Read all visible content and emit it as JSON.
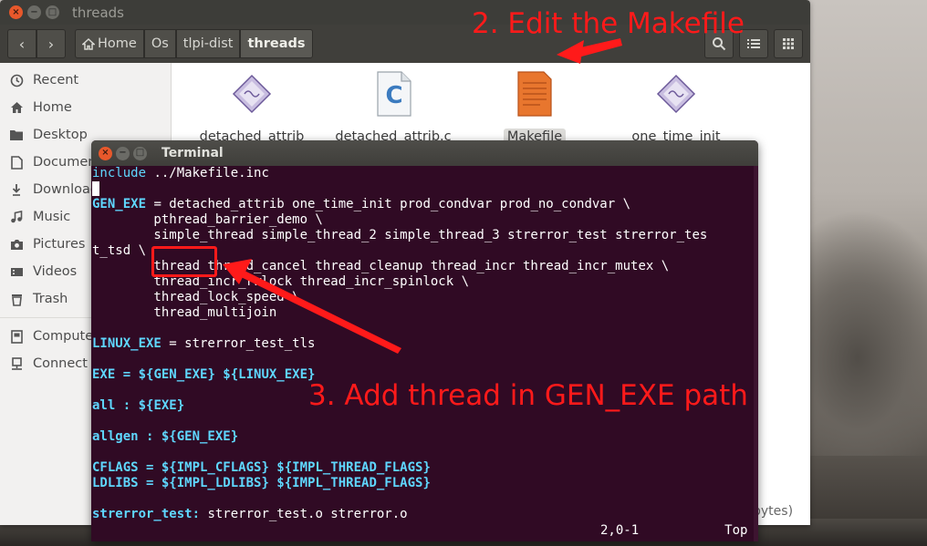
{
  "file_manager": {
    "title": "threads",
    "nav": {
      "back": "‹",
      "forward": "›"
    },
    "breadcrumbs": [
      "Home",
      "Os",
      "tlpi-dist",
      "threads"
    ],
    "sidebar": [
      {
        "label": "Recent",
        "icon": "clock-icon"
      },
      {
        "label": "Home",
        "icon": "home-icon"
      },
      {
        "label": "Desktop",
        "icon": "folder-icon"
      },
      {
        "label": "Documents",
        "icon": "document-icon"
      },
      {
        "label": "Downloads",
        "icon": "download-icon"
      },
      {
        "label": "Music",
        "icon": "music-icon"
      },
      {
        "label": "Pictures",
        "icon": "camera-icon"
      },
      {
        "label": "Videos",
        "icon": "video-icon"
      },
      {
        "label": "Trash",
        "icon": "trash-icon"
      },
      {
        "label": "Computer",
        "icon": "computer-icon"
      },
      {
        "label": "Connect to Server",
        "icon": "server-icon"
      }
    ],
    "files": [
      {
        "name": "detached_attrib",
        "type": "executable"
      },
      {
        "name": "detached_attrib.c",
        "type": "c-source"
      },
      {
        "name": "Makefile",
        "type": "makefile",
        "selected": true
      },
      {
        "name": "one_time_init",
        "type": "executable"
      }
    ],
    "status_fragment": "bytes)"
  },
  "terminal": {
    "title": "Terminal",
    "lines": [
      {
        "k": "include",
        "r": " ../Makefile.inc"
      },
      {
        "cursor": true
      },
      {
        "k": "GEN_EXE",
        "r": " = detached_attrib one_time_init prod_condvar prod_no_condvar \\"
      },
      {
        "r": "        pthread_barrier_demo \\"
      },
      {
        "r": "        simple_thread simple_thread_2 simple_thread_3 strerror_test strerror_tes"
      },
      {
        "r": "t_tsd \\"
      },
      {
        "r": "        thread thread_cancel thread_cleanup thread_incr thread_incr_mutex \\"
      },
      {
        "r": "        thread_incr_rwlock thread_incr_spinlock \\"
      },
      {
        "r": "        thread_lock_speed \\"
      },
      {
        "r": "        thread_multijoin"
      },
      {
        "r": ""
      },
      {
        "k": "LINUX_EXE",
        "r": " = strerror_test_tls"
      },
      {
        "r": ""
      },
      {
        "k": "EXE",
        "r": " = ${GEN_EXE} ${LINUX_EXE}",
        "bold": true
      },
      {
        "r": ""
      },
      {
        "k": "all",
        "r": " : ${EXE}",
        "bold": true
      },
      {
        "r": ""
      },
      {
        "k": "allgen",
        "r": " : ${GEN_EXE}",
        "bold": true
      },
      {
        "r": ""
      },
      {
        "k": "CFLAGS",
        "r": " = ${IMPL_CFLAGS} ${IMPL_THREAD_FLAGS}",
        "bold": true
      },
      {
        "k": "LDLIBS",
        "r": " = ${IMPL_LDLIBS} ${IMPL_THREAD_FLAGS}",
        "bold": true
      },
      {
        "r": ""
      },
      {
        "k": "strerror_test:",
        "r": " strerror_test.o strerror.o"
      }
    ],
    "position": "2,0-1",
    "scroll": "Top"
  },
  "annotations": {
    "step2": "2. Edit the Makefile",
    "step3": "3. Add thread in GEN_EXE path",
    "color": "#ff1a1a"
  }
}
